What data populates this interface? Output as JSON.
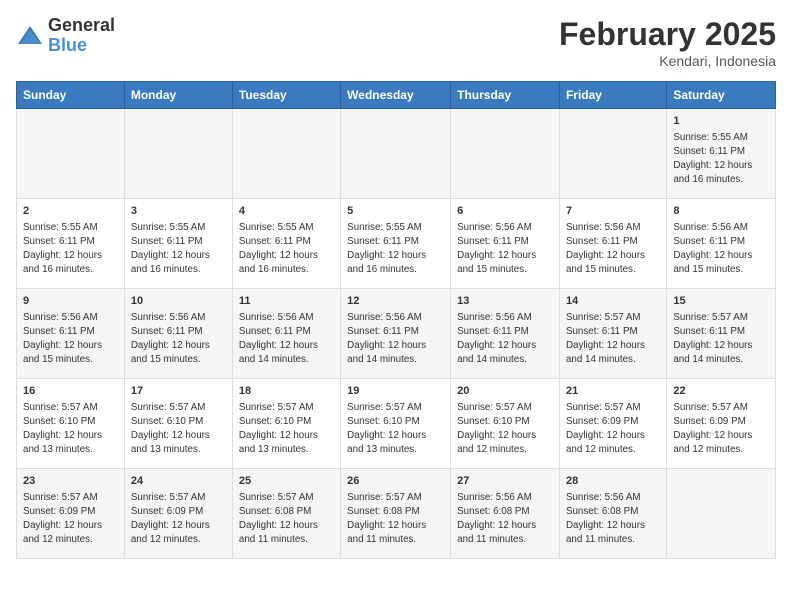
{
  "header": {
    "logo_general": "General",
    "logo_blue": "Blue",
    "month": "February 2025",
    "location": "Kendari, Indonesia"
  },
  "days_of_week": [
    "Sunday",
    "Monday",
    "Tuesday",
    "Wednesday",
    "Thursday",
    "Friday",
    "Saturday"
  ],
  "weeks": [
    {
      "days": [
        {
          "num": "",
          "info": ""
        },
        {
          "num": "",
          "info": ""
        },
        {
          "num": "",
          "info": ""
        },
        {
          "num": "",
          "info": ""
        },
        {
          "num": "",
          "info": ""
        },
        {
          "num": "",
          "info": ""
        },
        {
          "num": "1",
          "info": "Sunrise: 5:55 AM\nSunset: 6:11 PM\nDaylight: 12 hours\nand 16 minutes."
        }
      ]
    },
    {
      "days": [
        {
          "num": "2",
          "info": "Sunrise: 5:55 AM\nSunset: 6:11 PM\nDaylight: 12 hours\nand 16 minutes."
        },
        {
          "num": "3",
          "info": "Sunrise: 5:55 AM\nSunset: 6:11 PM\nDaylight: 12 hours\nand 16 minutes."
        },
        {
          "num": "4",
          "info": "Sunrise: 5:55 AM\nSunset: 6:11 PM\nDaylight: 12 hours\nand 16 minutes."
        },
        {
          "num": "5",
          "info": "Sunrise: 5:55 AM\nSunset: 6:11 PM\nDaylight: 12 hours\nand 16 minutes."
        },
        {
          "num": "6",
          "info": "Sunrise: 5:56 AM\nSunset: 6:11 PM\nDaylight: 12 hours\nand 15 minutes."
        },
        {
          "num": "7",
          "info": "Sunrise: 5:56 AM\nSunset: 6:11 PM\nDaylight: 12 hours\nand 15 minutes."
        },
        {
          "num": "8",
          "info": "Sunrise: 5:56 AM\nSunset: 6:11 PM\nDaylight: 12 hours\nand 15 minutes."
        }
      ]
    },
    {
      "days": [
        {
          "num": "9",
          "info": "Sunrise: 5:56 AM\nSunset: 6:11 PM\nDaylight: 12 hours\nand 15 minutes."
        },
        {
          "num": "10",
          "info": "Sunrise: 5:56 AM\nSunset: 6:11 PM\nDaylight: 12 hours\nand 15 minutes."
        },
        {
          "num": "11",
          "info": "Sunrise: 5:56 AM\nSunset: 6:11 PM\nDaylight: 12 hours\nand 14 minutes."
        },
        {
          "num": "12",
          "info": "Sunrise: 5:56 AM\nSunset: 6:11 PM\nDaylight: 12 hours\nand 14 minutes."
        },
        {
          "num": "13",
          "info": "Sunrise: 5:56 AM\nSunset: 6:11 PM\nDaylight: 12 hours\nand 14 minutes."
        },
        {
          "num": "14",
          "info": "Sunrise: 5:57 AM\nSunset: 6:11 PM\nDaylight: 12 hours\nand 14 minutes."
        },
        {
          "num": "15",
          "info": "Sunrise: 5:57 AM\nSunset: 6:11 PM\nDaylight: 12 hours\nand 14 minutes."
        }
      ]
    },
    {
      "days": [
        {
          "num": "16",
          "info": "Sunrise: 5:57 AM\nSunset: 6:10 PM\nDaylight: 12 hours\nand 13 minutes."
        },
        {
          "num": "17",
          "info": "Sunrise: 5:57 AM\nSunset: 6:10 PM\nDaylight: 12 hours\nand 13 minutes."
        },
        {
          "num": "18",
          "info": "Sunrise: 5:57 AM\nSunset: 6:10 PM\nDaylight: 12 hours\nand 13 minutes."
        },
        {
          "num": "19",
          "info": "Sunrise: 5:57 AM\nSunset: 6:10 PM\nDaylight: 12 hours\nand 13 minutes."
        },
        {
          "num": "20",
          "info": "Sunrise: 5:57 AM\nSunset: 6:10 PM\nDaylight: 12 hours\nand 12 minutes."
        },
        {
          "num": "21",
          "info": "Sunrise: 5:57 AM\nSunset: 6:09 PM\nDaylight: 12 hours\nand 12 minutes."
        },
        {
          "num": "22",
          "info": "Sunrise: 5:57 AM\nSunset: 6:09 PM\nDaylight: 12 hours\nand 12 minutes."
        }
      ]
    },
    {
      "days": [
        {
          "num": "23",
          "info": "Sunrise: 5:57 AM\nSunset: 6:09 PM\nDaylight: 12 hours\nand 12 minutes."
        },
        {
          "num": "24",
          "info": "Sunrise: 5:57 AM\nSunset: 6:09 PM\nDaylight: 12 hours\nand 12 minutes."
        },
        {
          "num": "25",
          "info": "Sunrise: 5:57 AM\nSunset: 6:08 PM\nDaylight: 12 hours\nand 11 minutes."
        },
        {
          "num": "26",
          "info": "Sunrise: 5:57 AM\nSunset: 6:08 PM\nDaylight: 12 hours\nand 11 minutes."
        },
        {
          "num": "27",
          "info": "Sunrise: 5:56 AM\nSunset: 6:08 PM\nDaylight: 12 hours\nand 11 minutes."
        },
        {
          "num": "28",
          "info": "Sunrise: 5:56 AM\nSunset: 6:08 PM\nDaylight: 12 hours\nand 11 minutes."
        },
        {
          "num": "",
          "info": ""
        }
      ]
    }
  ]
}
